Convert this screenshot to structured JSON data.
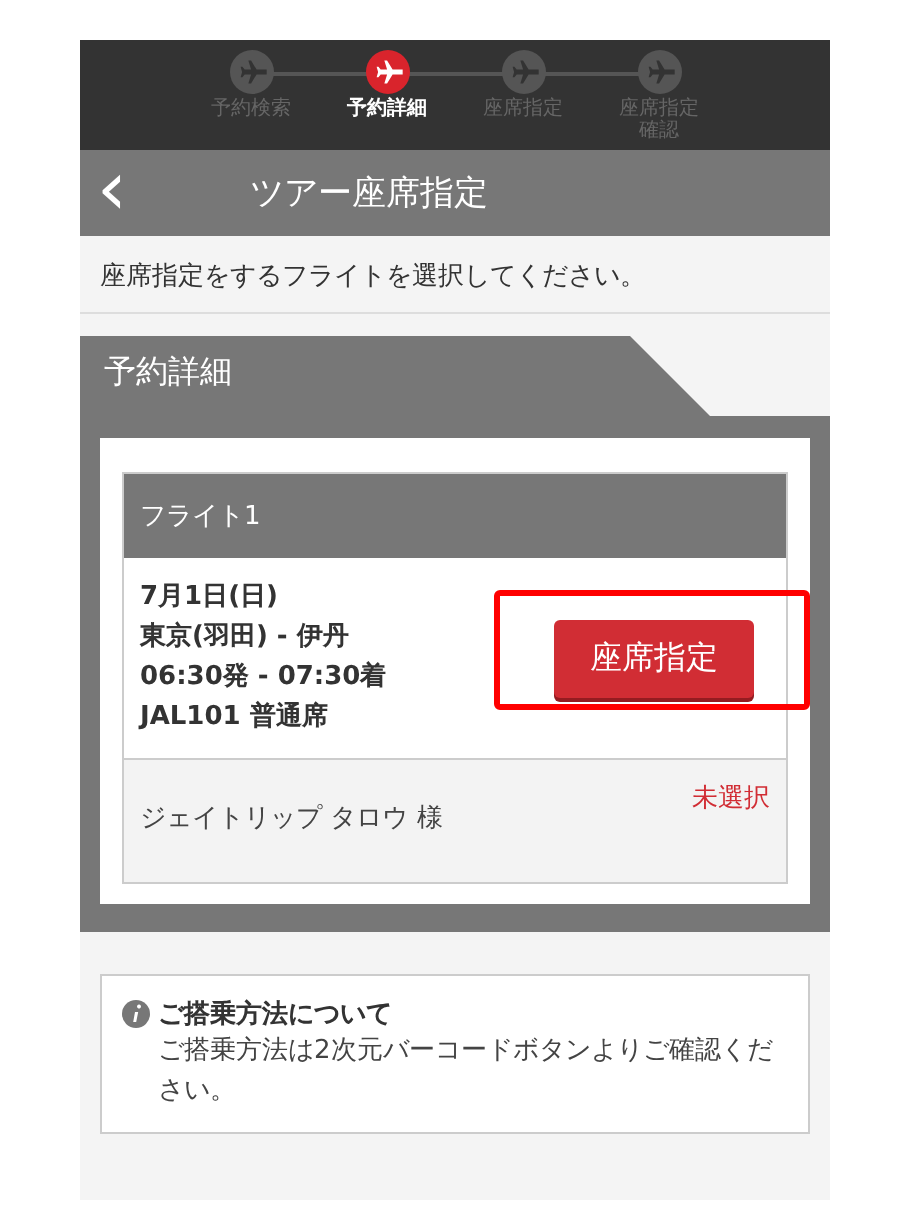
{
  "steps": [
    {
      "label": "予約検索",
      "selected": false
    },
    {
      "label": "予約詳細",
      "selected": true
    },
    {
      "label": "座席指定",
      "selected": false
    },
    {
      "label": "座席指定確認",
      "selected": false
    }
  ],
  "header": {
    "back": "‹",
    "title": "ツアー座席指定"
  },
  "instruction": "座席指定をするフライトを選択してください。",
  "section": {
    "title": "予約詳細"
  },
  "flights": [
    {
      "title": "フライト1",
      "lines": [
        "7月1日(日)",
        "東京(羽田) - 伊丹",
        "06:30発 - 07:30着",
        "JAL101 普通席"
      ],
      "button": {
        "label": "座席指定",
        "highlighted": true
      },
      "passenger": "ジェイトリップ タロウ 様",
      "status": "未選択"
    }
  ],
  "notice": {
    "title": "ご搭乗方法について",
    "body": "ご搭乗方法は2次元バーコードボタンよりご確認ください。"
  }
}
